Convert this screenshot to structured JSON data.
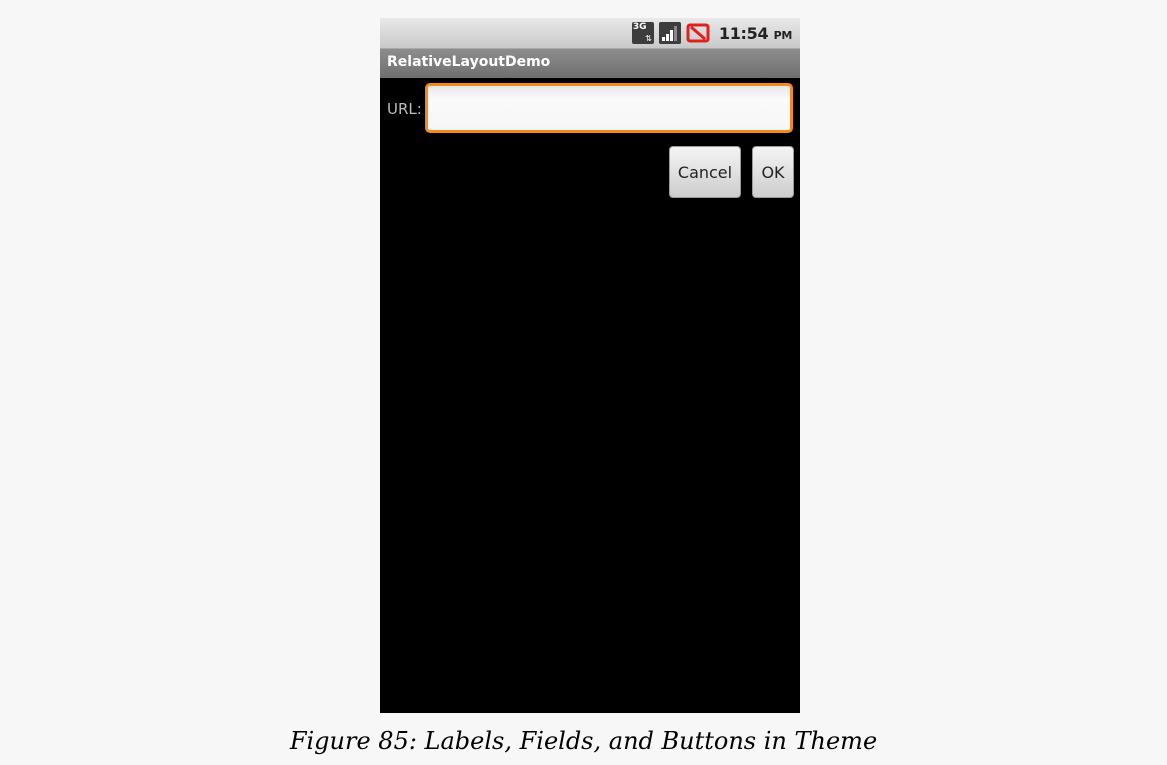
{
  "status_bar": {
    "network_icon_text": "3G",
    "icons": [
      "network-3g-icon",
      "signal-strength-icon",
      "no-signal-icon"
    ],
    "time": "11:54",
    "ampm": "PM"
  },
  "app": {
    "title": "RelativeLayoutDemo"
  },
  "form": {
    "url_label": "URL:",
    "url_value": "",
    "cancel_label": "Cancel",
    "ok_label": "OK"
  },
  "caption": "Figure 85: Labels, Fields, and Buttons in Theme",
  "colors": {
    "focus_border": "#f48a1e",
    "screen_background": "#000000",
    "title_bar": "#7a7a7a",
    "no_signal_red": "#e02020"
  }
}
